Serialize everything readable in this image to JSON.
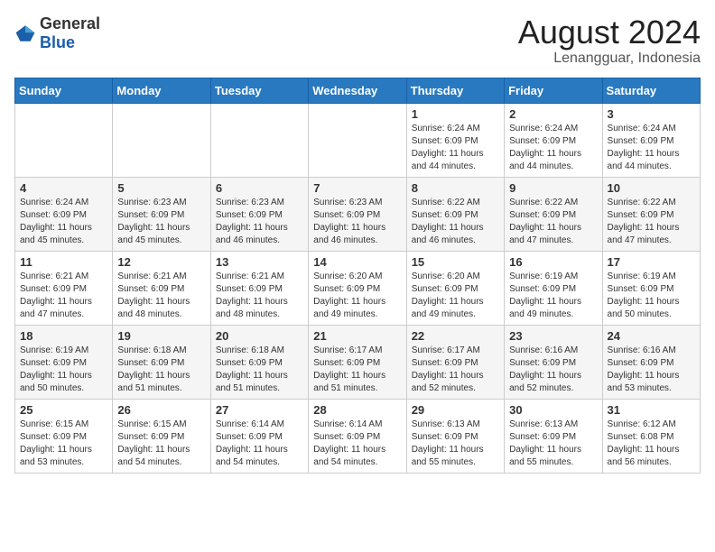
{
  "logo": {
    "general": "General",
    "blue": "Blue"
  },
  "header": {
    "month": "August 2024",
    "location": "Lenangguar, Indonesia"
  },
  "weekdays": [
    "Sunday",
    "Monday",
    "Tuesday",
    "Wednesday",
    "Thursday",
    "Friday",
    "Saturday"
  ],
  "weeks": [
    [
      {
        "day": "",
        "info": ""
      },
      {
        "day": "",
        "info": ""
      },
      {
        "day": "",
        "info": ""
      },
      {
        "day": "",
        "info": ""
      },
      {
        "day": "1",
        "info": "Sunrise: 6:24 AM\nSunset: 6:09 PM\nDaylight: 11 hours\nand 44 minutes."
      },
      {
        "day": "2",
        "info": "Sunrise: 6:24 AM\nSunset: 6:09 PM\nDaylight: 11 hours\nand 44 minutes."
      },
      {
        "day": "3",
        "info": "Sunrise: 6:24 AM\nSunset: 6:09 PM\nDaylight: 11 hours\nand 44 minutes."
      }
    ],
    [
      {
        "day": "4",
        "info": "Sunrise: 6:24 AM\nSunset: 6:09 PM\nDaylight: 11 hours\nand 45 minutes."
      },
      {
        "day": "5",
        "info": "Sunrise: 6:23 AM\nSunset: 6:09 PM\nDaylight: 11 hours\nand 45 minutes."
      },
      {
        "day": "6",
        "info": "Sunrise: 6:23 AM\nSunset: 6:09 PM\nDaylight: 11 hours\nand 46 minutes."
      },
      {
        "day": "7",
        "info": "Sunrise: 6:23 AM\nSunset: 6:09 PM\nDaylight: 11 hours\nand 46 minutes."
      },
      {
        "day": "8",
        "info": "Sunrise: 6:22 AM\nSunset: 6:09 PM\nDaylight: 11 hours\nand 46 minutes."
      },
      {
        "day": "9",
        "info": "Sunrise: 6:22 AM\nSunset: 6:09 PM\nDaylight: 11 hours\nand 47 minutes."
      },
      {
        "day": "10",
        "info": "Sunrise: 6:22 AM\nSunset: 6:09 PM\nDaylight: 11 hours\nand 47 minutes."
      }
    ],
    [
      {
        "day": "11",
        "info": "Sunrise: 6:21 AM\nSunset: 6:09 PM\nDaylight: 11 hours\nand 47 minutes."
      },
      {
        "day": "12",
        "info": "Sunrise: 6:21 AM\nSunset: 6:09 PM\nDaylight: 11 hours\nand 48 minutes."
      },
      {
        "day": "13",
        "info": "Sunrise: 6:21 AM\nSunset: 6:09 PM\nDaylight: 11 hours\nand 48 minutes."
      },
      {
        "day": "14",
        "info": "Sunrise: 6:20 AM\nSunset: 6:09 PM\nDaylight: 11 hours\nand 49 minutes."
      },
      {
        "day": "15",
        "info": "Sunrise: 6:20 AM\nSunset: 6:09 PM\nDaylight: 11 hours\nand 49 minutes."
      },
      {
        "day": "16",
        "info": "Sunrise: 6:19 AM\nSunset: 6:09 PM\nDaylight: 11 hours\nand 49 minutes."
      },
      {
        "day": "17",
        "info": "Sunrise: 6:19 AM\nSunset: 6:09 PM\nDaylight: 11 hours\nand 50 minutes."
      }
    ],
    [
      {
        "day": "18",
        "info": "Sunrise: 6:19 AM\nSunset: 6:09 PM\nDaylight: 11 hours\nand 50 minutes."
      },
      {
        "day": "19",
        "info": "Sunrise: 6:18 AM\nSunset: 6:09 PM\nDaylight: 11 hours\nand 51 minutes."
      },
      {
        "day": "20",
        "info": "Sunrise: 6:18 AM\nSunset: 6:09 PM\nDaylight: 11 hours\nand 51 minutes."
      },
      {
        "day": "21",
        "info": "Sunrise: 6:17 AM\nSunset: 6:09 PM\nDaylight: 11 hours\nand 51 minutes."
      },
      {
        "day": "22",
        "info": "Sunrise: 6:17 AM\nSunset: 6:09 PM\nDaylight: 11 hours\nand 52 minutes."
      },
      {
        "day": "23",
        "info": "Sunrise: 6:16 AM\nSunset: 6:09 PM\nDaylight: 11 hours\nand 52 minutes."
      },
      {
        "day": "24",
        "info": "Sunrise: 6:16 AM\nSunset: 6:09 PM\nDaylight: 11 hours\nand 53 minutes."
      }
    ],
    [
      {
        "day": "25",
        "info": "Sunrise: 6:15 AM\nSunset: 6:09 PM\nDaylight: 11 hours\nand 53 minutes."
      },
      {
        "day": "26",
        "info": "Sunrise: 6:15 AM\nSunset: 6:09 PM\nDaylight: 11 hours\nand 54 minutes."
      },
      {
        "day": "27",
        "info": "Sunrise: 6:14 AM\nSunset: 6:09 PM\nDaylight: 11 hours\nand 54 minutes."
      },
      {
        "day": "28",
        "info": "Sunrise: 6:14 AM\nSunset: 6:09 PM\nDaylight: 11 hours\nand 54 minutes."
      },
      {
        "day": "29",
        "info": "Sunrise: 6:13 AM\nSunset: 6:09 PM\nDaylight: 11 hours\nand 55 minutes."
      },
      {
        "day": "30",
        "info": "Sunrise: 6:13 AM\nSunset: 6:09 PM\nDaylight: 11 hours\nand 55 minutes."
      },
      {
        "day": "31",
        "info": "Sunrise: 6:12 AM\nSunset: 6:08 PM\nDaylight: 11 hours\nand 56 minutes."
      }
    ]
  ]
}
